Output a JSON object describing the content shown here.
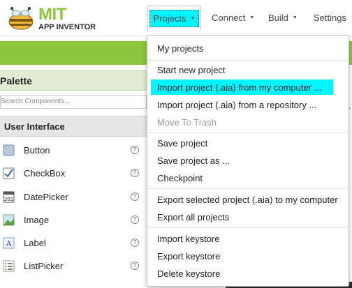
{
  "brand": {
    "name": "MIT",
    "product": "APP INVENTOR"
  },
  "nav": {
    "projects": "Projects",
    "connect": "Connect",
    "build": "Build",
    "settings": "Settings",
    "caret": "▼"
  },
  "palette": {
    "title": "Palette",
    "search_placeholder": "Search Components...",
    "category": "User Interface",
    "help_glyph": "?",
    "components": [
      {
        "label": "Button",
        "icon": "button-icon"
      },
      {
        "label": "CheckBox",
        "icon": "checkbox-icon"
      },
      {
        "label": "DatePicker",
        "icon": "datepicker-icon"
      },
      {
        "label": "Image",
        "icon": "image-icon"
      },
      {
        "label": "Label",
        "icon": "label-icon"
      },
      {
        "label": "ListPicker",
        "icon": "listpicker-icon"
      }
    ]
  },
  "viewer": {
    "partial_text": "..."
  },
  "projects_menu": {
    "items": [
      "My projects",
      "Start new project",
      "Import project (.aia) from my computer ...",
      "Import project (.aia) from a repository ...",
      "Move To Trash",
      "Save project",
      "Save project as ...",
      "Checkpoint",
      "Export selected project (.aia) to my computer",
      "Export all projects",
      "Import keystore",
      "Export keystore",
      "Delete keystore"
    ],
    "highlighted_index": 2,
    "disabled_index": 4
  },
  "colors": {
    "accent_green": "#8dc63f",
    "highlight_cyan": "#00f5ff",
    "palette_header": "#e1ecd3"
  }
}
